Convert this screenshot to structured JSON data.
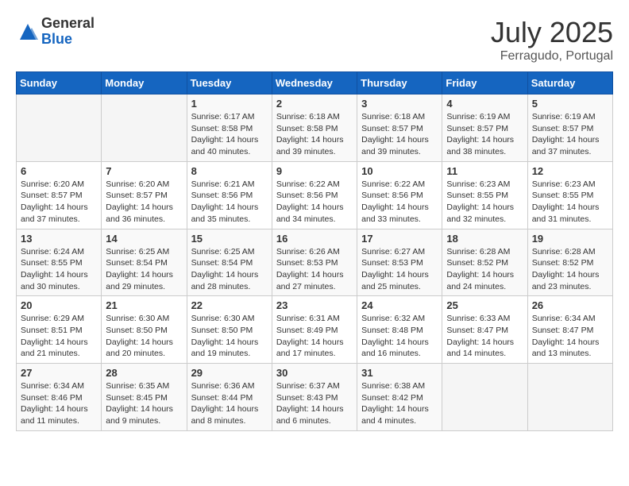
{
  "logo": {
    "general": "General",
    "blue": "Blue"
  },
  "title": "July 2025",
  "subtitle": "Ferragudo, Portugal",
  "days": [
    "Sunday",
    "Monday",
    "Tuesday",
    "Wednesday",
    "Thursday",
    "Friday",
    "Saturday"
  ],
  "weeks": [
    [
      {
        "day": "",
        "sunrise": "",
        "sunset": "",
        "daylight": ""
      },
      {
        "day": "",
        "sunrise": "",
        "sunset": "",
        "daylight": ""
      },
      {
        "day": "1",
        "sunrise": "Sunrise: 6:17 AM",
        "sunset": "Sunset: 8:58 PM",
        "daylight": "Daylight: 14 hours and 40 minutes."
      },
      {
        "day": "2",
        "sunrise": "Sunrise: 6:18 AM",
        "sunset": "Sunset: 8:58 PM",
        "daylight": "Daylight: 14 hours and 39 minutes."
      },
      {
        "day": "3",
        "sunrise": "Sunrise: 6:18 AM",
        "sunset": "Sunset: 8:57 PM",
        "daylight": "Daylight: 14 hours and 39 minutes."
      },
      {
        "day": "4",
        "sunrise": "Sunrise: 6:19 AM",
        "sunset": "Sunset: 8:57 PM",
        "daylight": "Daylight: 14 hours and 38 minutes."
      },
      {
        "day": "5",
        "sunrise": "Sunrise: 6:19 AM",
        "sunset": "Sunset: 8:57 PM",
        "daylight": "Daylight: 14 hours and 37 minutes."
      }
    ],
    [
      {
        "day": "6",
        "sunrise": "Sunrise: 6:20 AM",
        "sunset": "Sunset: 8:57 PM",
        "daylight": "Daylight: 14 hours and 37 minutes."
      },
      {
        "day": "7",
        "sunrise": "Sunrise: 6:20 AM",
        "sunset": "Sunset: 8:57 PM",
        "daylight": "Daylight: 14 hours and 36 minutes."
      },
      {
        "day": "8",
        "sunrise": "Sunrise: 6:21 AM",
        "sunset": "Sunset: 8:56 PM",
        "daylight": "Daylight: 14 hours and 35 minutes."
      },
      {
        "day": "9",
        "sunrise": "Sunrise: 6:22 AM",
        "sunset": "Sunset: 8:56 PM",
        "daylight": "Daylight: 14 hours and 34 minutes."
      },
      {
        "day": "10",
        "sunrise": "Sunrise: 6:22 AM",
        "sunset": "Sunset: 8:56 PM",
        "daylight": "Daylight: 14 hours and 33 minutes."
      },
      {
        "day": "11",
        "sunrise": "Sunrise: 6:23 AM",
        "sunset": "Sunset: 8:55 PM",
        "daylight": "Daylight: 14 hours and 32 minutes."
      },
      {
        "day": "12",
        "sunrise": "Sunrise: 6:23 AM",
        "sunset": "Sunset: 8:55 PM",
        "daylight": "Daylight: 14 hours and 31 minutes."
      }
    ],
    [
      {
        "day": "13",
        "sunrise": "Sunrise: 6:24 AM",
        "sunset": "Sunset: 8:55 PM",
        "daylight": "Daylight: 14 hours and 30 minutes."
      },
      {
        "day": "14",
        "sunrise": "Sunrise: 6:25 AM",
        "sunset": "Sunset: 8:54 PM",
        "daylight": "Daylight: 14 hours and 29 minutes."
      },
      {
        "day": "15",
        "sunrise": "Sunrise: 6:25 AM",
        "sunset": "Sunset: 8:54 PM",
        "daylight": "Daylight: 14 hours and 28 minutes."
      },
      {
        "day": "16",
        "sunrise": "Sunrise: 6:26 AM",
        "sunset": "Sunset: 8:53 PM",
        "daylight": "Daylight: 14 hours and 27 minutes."
      },
      {
        "day": "17",
        "sunrise": "Sunrise: 6:27 AM",
        "sunset": "Sunset: 8:53 PM",
        "daylight": "Daylight: 14 hours and 25 minutes."
      },
      {
        "day": "18",
        "sunrise": "Sunrise: 6:28 AM",
        "sunset": "Sunset: 8:52 PM",
        "daylight": "Daylight: 14 hours and 24 minutes."
      },
      {
        "day": "19",
        "sunrise": "Sunrise: 6:28 AM",
        "sunset": "Sunset: 8:52 PM",
        "daylight": "Daylight: 14 hours and 23 minutes."
      }
    ],
    [
      {
        "day": "20",
        "sunrise": "Sunrise: 6:29 AM",
        "sunset": "Sunset: 8:51 PM",
        "daylight": "Daylight: 14 hours and 21 minutes."
      },
      {
        "day": "21",
        "sunrise": "Sunrise: 6:30 AM",
        "sunset": "Sunset: 8:50 PM",
        "daylight": "Daylight: 14 hours and 20 minutes."
      },
      {
        "day": "22",
        "sunrise": "Sunrise: 6:30 AM",
        "sunset": "Sunset: 8:50 PM",
        "daylight": "Daylight: 14 hours and 19 minutes."
      },
      {
        "day": "23",
        "sunrise": "Sunrise: 6:31 AM",
        "sunset": "Sunset: 8:49 PM",
        "daylight": "Daylight: 14 hours and 17 minutes."
      },
      {
        "day": "24",
        "sunrise": "Sunrise: 6:32 AM",
        "sunset": "Sunset: 8:48 PM",
        "daylight": "Daylight: 14 hours and 16 minutes."
      },
      {
        "day": "25",
        "sunrise": "Sunrise: 6:33 AM",
        "sunset": "Sunset: 8:47 PM",
        "daylight": "Daylight: 14 hours and 14 minutes."
      },
      {
        "day": "26",
        "sunrise": "Sunrise: 6:34 AM",
        "sunset": "Sunset: 8:47 PM",
        "daylight": "Daylight: 14 hours and 13 minutes."
      }
    ],
    [
      {
        "day": "27",
        "sunrise": "Sunrise: 6:34 AM",
        "sunset": "Sunset: 8:46 PM",
        "daylight": "Daylight: 14 hours and 11 minutes."
      },
      {
        "day": "28",
        "sunrise": "Sunrise: 6:35 AM",
        "sunset": "Sunset: 8:45 PM",
        "daylight": "Daylight: 14 hours and 9 minutes."
      },
      {
        "day": "29",
        "sunrise": "Sunrise: 6:36 AM",
        "sunset": "Sunset: 8:44 PM",
        "daylight": "Daylight: 14 hours and 8 minutes."
      },
      {
        "day": "30",
        "sunrise": "Sunrise: 6:37 AM",
        "sunset": "Sunset: 8:43 PM",
        "daylight": "Daylight: 14 hours and 6 minutes."
      },
      {
        "day": "31",
        "sunrise": "Sunrise: 6:38 AM",
        "sunset": "Sunset: 8:42 PM",
        "daylight": "Daylight: 14 hours and 4 minutes."
      },
      {
        "day": "",
        "sunrise": "",
        "sunset": "",
        "daylight": ""
      },
      {
        "day": "",
        "sunrise": "",
        "sunset": "",
        "daylight": ""
      }
    ]
  ]
}
